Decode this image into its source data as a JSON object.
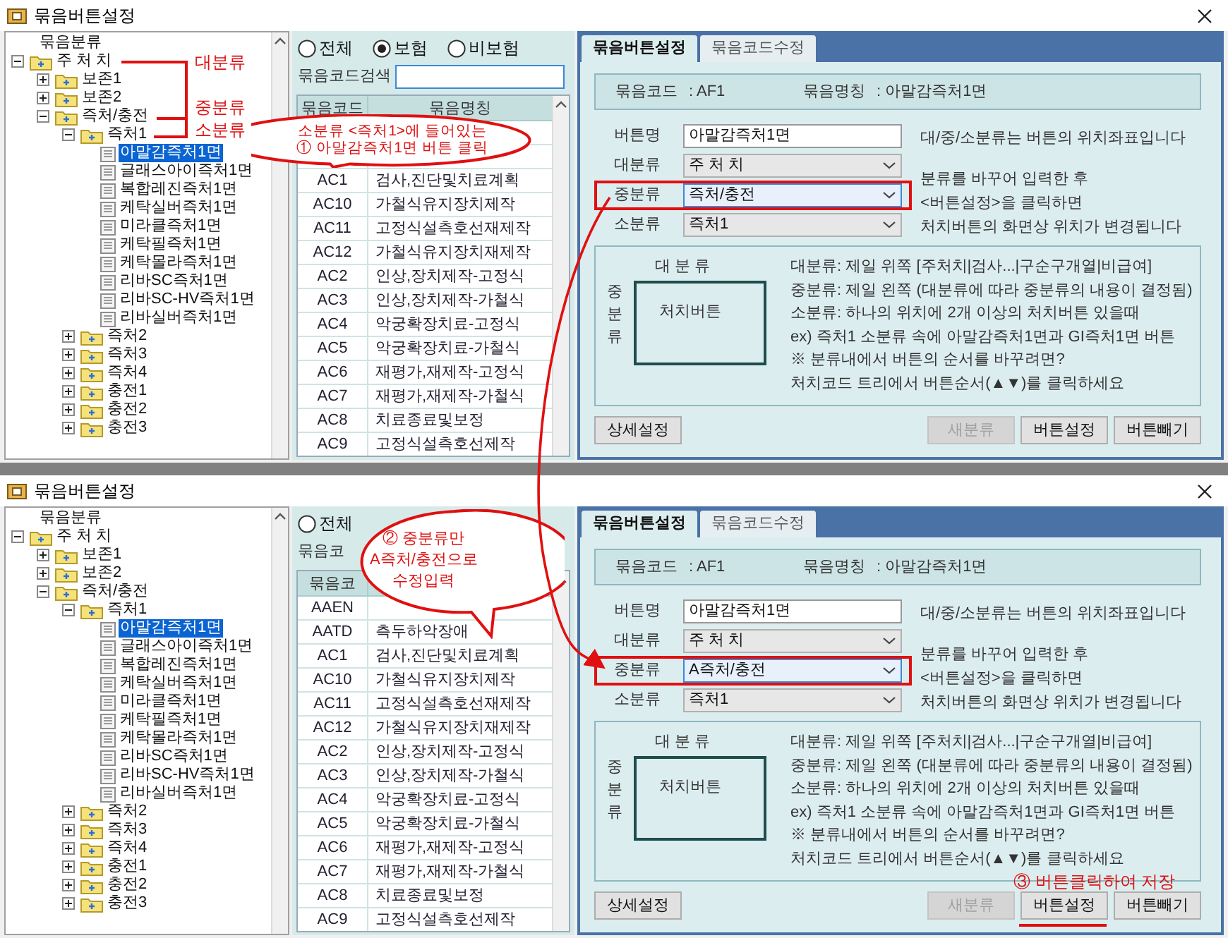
{
  "windows": [
    {
      "title": "묶음버튼설정",
      "tree": {
        "header": "묶음분류",
        "items": [
          {
            "label": "주 처 치",
            "kind": "folder",
            "expanded": true,
            "selected": false,
            "children": [
              {
                "label": "보존1",
                "kind": "folder",
                "expanded": false,
                "selected": false
              },
              {
                "label": "보존2",
                "kind": "folder",
                "expanded": false,
                "selected": false
              },
              {
                "label": "즉처/충전",
                "kind": "folder",
                "expanded": true,
                "selected": false,
                "children": [
                  {
                    "label": "즉처1",
                    "kind": "folder",
                    "expanded": true,
                    "selected": false,
                    "children": [
                      {
                        "label": "아말감즉처1면",
                        "kind": "leaf",
                        "selected": true
                      },
                      {
                        "label": "글래스아이즉처1면",
                        "kind": "leaf",
                        "selected": false
                      },
                      {
                        "label": "복합레진즉처1면",
                        "kind": "leaf",
                        "selected": false
                      },
                      {
                        "label": "케탁실버즉처1면",
                        "kind": "leaf",
                        "selected": false
                      },
                      {
                        "label": "미라클즉처1면",
                        "kind": "leaf",
                        "selected": false
                      },
                      {
                        "label": "케탁필즉처1면",
                        "kind": "leaf",
                        "selected": false
                      },
                      {
                        "label": "케탁몰라즉처1면",
                        "kind": "leaf",
                        "selected": false
                      },
                      {
                        "label": "리바SC즉처1면",
                        "kind": "leaf",
                        "selected": false
                      },
                      {
                        "label": "리바SC-HV즉처1면",
                        "kind": "leaf",
                        "selected": false
                      },
                      {
                        "label": "리바실버즉처1면",
                        "kind": "leaf",
                        "selected": false
                      }
                    ]
                  },
                  {
                    "label": "즉처2",
                    "kind": "folder",
                    "expanded": false,
                    "selected": false
                  },
                  {
                    "label": "즉처3",
                    "kind": "folder",
                    "expanded": false,
                    "selected": false
                  },
                  {
                    "label": "즉처4",
                    "kind": "folder",
                    "expanded": false,
                    "selected": false
                  },
                  {
                    "label": "충전1",
                    "kind": "folder",
                    "expanded": false,
                    "selected": false
                  },
                  {
                    "label": "충전2",
                    "kind": "folder",
                    "expanded": false,
                    "selected": false
                  },
                  {
                    "label": "충전3",
                    "kind": "folder",
                    "expanded": false,
                    "selected": false
                  }
                ]
              }
            ]
          }
        ]
      },
      "filters": [
        {
          "label": "전체",
          "selected": false
        },
        {
          "label": "보험",
          "selected": true
        },
        {
          "label": "비보험",
          "selected": false
        }
      ],
      "search": {
        "label": "묶음코드검색",
        "field": true
      },
      "list": {
        "columns": [
          "묶음코드",
          "묶음명칭"
        ],
        "rows": [
          {},
          {},
          {
            "code": "AC1",
            "name": "검사,진단및치료계획"
          },
          {
            "code": "AC10",
            "name": "가철식유지장치제작"
          },
          {
            "code": "AC11",
            "name": "고정식설측호선재제작"
          },
          {
            "code": "AC12",
            "name": "가철식유지장치재제작"
          },
          {
            "code": "AC2",
            "name": "인상,장치제작-고정식"
          },
          {
            "code": "AC3",
            "name": "인상,장치제작-가철식"
          },
          {
            "code": "AC4",
            "name": "악궁확장치료-고정식"
          },
          {
            "code": "AC5",
            "name": "악궁확장치료-가철식"
          },
          {
            "code": "AC6",
            "name": "재평가,재제작-고정식"
          },
          {
            "code": "AC7",
            "name": "재평가,재제작-가철식"
          },
          {
            "code": "AC8",
            "name": "치료종료및보정"
          },
          {
            "code": "AC9",
            "name": "고정식설측호선제작"
          }
        ]
      },
      "tabs": [
        {
          "label": "묶음버튼설정",
          "selected": true
        },
        {
          "label": "묶음코드수정",
          "selected": false
        }
      ],
      "info": [
        {
          "label": "묶음코드",
          "value": ": AF1"
        },
        {
          "label": "묶음명칭",
          "value": ": 아말감즉처1면"
        }
      ],
      "form": [
        {
          "label": "버튼명",
          "kind": "text",
          "value": "아말감즉처1면",
          "highlighted": false
        },
        {
          "label": "대분류",
          "kind": "select",
          "value": "주 처 치",
          "highlighted": false
        },
        {
          "label": "중분류",
          "kind": "select",
          "value": "즉처/충전",
          "highlighted": true
        },
        {
          "label": "소분류",
          "kind": "select",
          "value": "즉처1",
          "highlighted": false
        }
      ],
      "notes": [
        [
          "대/중/소분류는 버튼의 위치좌표입니다"
        ],
        [
          "분류를 바꾸어 입력한 후",
          "<버튼설정>을 클릭하면",
          "처치버튼의 화면상 위치가 변경됩니다"
        ]
      ],
      "diagram": {
        "top": "대 분 류",
        "side": "중분류",
        "box": "처치버튼"
      },
      "legend": [
        "대분류: 제일 위쪽 [주처치|검사...|구순구개열|비급여]",
        "중분류: 제일 왼쪽 (대분류에 따라 중분류의 내용이 결정됨)",
        "소분류: 하나의 위치에 2개 이상의 처치버튼 있을때",
        "ex) 즉처1 소분류 속에 아말감즉처1면과 GI즉처1면 버튼",
        "※ 분류내에서 버튼의 순서를 바꾸려면?",
        "처치코드 트리에서 버튼순서(▲▼)를 클릭하세요"
      ],
      "buttons": [
        {
          "label": "상세설정",
          "disabled": false
        },
        {
          "label": "새분류",
          "disabled": true
        },
        {
          "label": "버튼설정",
          "disabled": false
        },
        {
          "label": "버튼빼기",
          "disabled": false
        }
      ],
      "annotations": {
        "bracket_labels": [
          "대분류",
          "중분류",
          "소분류"
        ],
        "callout": [
          "소분류 <즉처1>에 들어있는",
          "① 아말감즉처1면 버튼 클릭"
        ]
      }
    },
    {
      "title": "묶음버튼설정",
      "tree": {
        "header": "묶음분류",
        "items": [
          {
            "label": "주 처 치",
            "kind": "folder",
            "expanded": true,
            "selected": false,
            "children": [
              {
                "label": "보존1",
                "kind": "folder",
                "expanded": false,
                "selected": false
              },
              {
                "label": "보존2",
                "kind": "folder",
                "expanded": false,
                "selected": false
              },
              {
                "label": "즉처/충전",
                "kind": "folder",
                "expanded": true,
                "selected": false,
                "children": [
                  {
                    "label": "즉처1",
                    "kind": "folder",
                    "expanded": true,
                    "selected": false,
                    "children": [
                      {
                        "label": "아말감즉처1면",
                        "kind": "leaf",
                        "selected": true
                      },
                      {
                        "label": "글래스아이즉처1면",
                        "kind": "leaf",
                        "selected": false
                      },
                      {
                        "label": "복합레진즉처1면",
                        "kind": "leaf",
                        "selected": false
                      },
                      {
                        "label": "케탁실버즉처1면",
                        "kind": "leaf",
                        "selected": false
                      },
                      {
                        "label": "미라클즉처1면",
                        "kind": "leaf",
                        "selected": false
                      },
                      {
                        "label": "케탁필즉처1면",
                        "kind": "leaf",
                        "selected": false
                      },
                      {
                        "label": "케탁몰라즉처1면",
                        "kind": "leaf",
                        "selected": false
                      },
                      {
                        "label": "리바SC즉처1면",
                        "kind": "leaf",
                        "selected": false
                      },
                      {
                        "label": "리바SC-HV즉처1면",
                        "kind": "leaf",
                        "selected": false
                      },
                      {
                        "label": "리바실버즉처1면",
                        "kind": "leaf",
                        "selected": false
                      }
                    ]
                  },
                  {
                    "label": "즉처2",
                    "kind": "folder",
                    "expanded": false,
                    "selected": false
                  },
                  {
                    "label": "즉처3",
                    "kind": "folder",
                    "expanded": false,
                    "selected": false
                  },
                  {
                    "label": "즉처4",
                    "kind": "folder",
                    "expanded": false,
                    "selected": false
                  },
                  {
                    "label": "충전1",
                    "kind": "folder",
                    "expanded": false,
                    "selected": false
                  },
                  {
                    "label": "충전2",
                    "kind": "folder",
                    "expanded": false,
                    "selected": false
                  },
                  {
                    "label": "충전3",
                    "kind": "folder",
                    "expanded": false,
                    "selected": false
                  }
                ]
              }
            ]
          }
        ]
      },
      "filters": [
        {
          "label": "전체",
          "selected": false
        }
      ],
      "search": {
        "label": "묶음코",
        "field": false
      },
      "list": {
        "columns": [
          "묶음코"
        ],
        "rows": [
          {
            "code": "AAEN"
          },
          {
            "code": "AATD",
            "name": "측두하악장애"
          },
          {
            "code": "AC1",
            "name": "검사,진단및치료계획"
          },
          {
            "code": "AC10",
            "name": "가철식유지장치제작"
          },
          {
            "code": "AC11",
            "name": "고정식설측호선재제작"
          },
          {
            "code": "AC12",
            "name": "가철식유지장치재제작"
          },
          {
            "code": "AC2",
            "name": "인상,장치제작-고정식"
          },
          {
            "code": "AC3",
            "name": "인상,장치제작-가철식"
          },
          {
            "code": "AC4",
            "name": "악궁확장치료-고정식"
          },
          {
            "code": "AC5",
            "name": "악궁확장치료-가철식"
          },
          {
            "code": "AC6",
            "name": "재평가,재제작-고정식"
          },
          {
            "code": "AC7",
            "name": "재평가,재제작-가철식"
          },
          {
            "code": "AC8",
            "name": "치료종료및보정"
          },
          {
            "code": "AC9",
            "name": "고정식설측호선제작"
          }
        ]
      },
      "tabs": [
        {
          "label": "묶음버튼설정",
          "selected": true
        },
        {
          "label": "묶음코드수정",
          "selected": false
        }
      ],
      "info": [
        {
          "label": "묶음코드",
          "value": ": AF1"
        },
        {
          "label": "묶음명칭",
          "value": ": 아말감즉처1면"
        }
      ],
      "form": [
        {
          "label": "버튼명",
          "kind": "text",
          "value": "아말감즉처1면",
          "highlighted": false
        },
        {
          "label": "대분류",
          "kind": "select",
          "value": "주 처 치",
          "highlighted": false
        },
        {
          "label": "중분류",
          "kind": "select",
          "value": "A즉처/충전",
          "highlighted": true
        },
        {
          "label": "소분류",
          "kind": "select",
          "value": "즉처1",
          "highlighted": false
        }
      ],
      "notes": [
        [
          "대/중/소분류는 버튼의 위치좌표입니다"
        ],
        [
          "분류를 바꾸어 입력한 후",
          "<버튼설정>을 클릭하면",
          "처치버튼의 화면상 위치가 변경됩니다"
        ]
      ],
      "diagram": {
        "top": "대 분 류",
        "side": "중분류",
        "box": "처치버튼"
      },
      "legend": [
        "대분류: 제일 위쪽 [주처치|검사...|구순구개열|비급여]",
        "중분류: 제일 왼쪽 (대분류에 따라 중분류의 내용이 결정됨)",
        "소분류: 하나의 위치에 2개 이상의 처치버튼 있을때",
        "ex) 즉처1 소분류 속에 아말감즉처1면과 GI즉처1면 버튼",
        "※ 분류내에서 버튼의 순서를 바꾸려면?",
        "처치코드 트리에서 버튼순서(▲▼)를 클릭하세요"
      ],
      "buttons": [
        {
          "label": "상세설정",
          "disabled": false
        },
        {
          "label": "새분류",
          "disabled": true
        },
        {
          "label": "버튼설정",
          "disabled": false
        },
        {
          "label": "버튼빼기",
          "disabled": false
        }
      ],
      "annotations": {
        "callout": [
          "② 중분류만",
          "A즉처/충전으로",
          "수정입력"
        ],
        "save_note": "③ 버튼클릭하여 저장"
      }
    }
  ]
}
